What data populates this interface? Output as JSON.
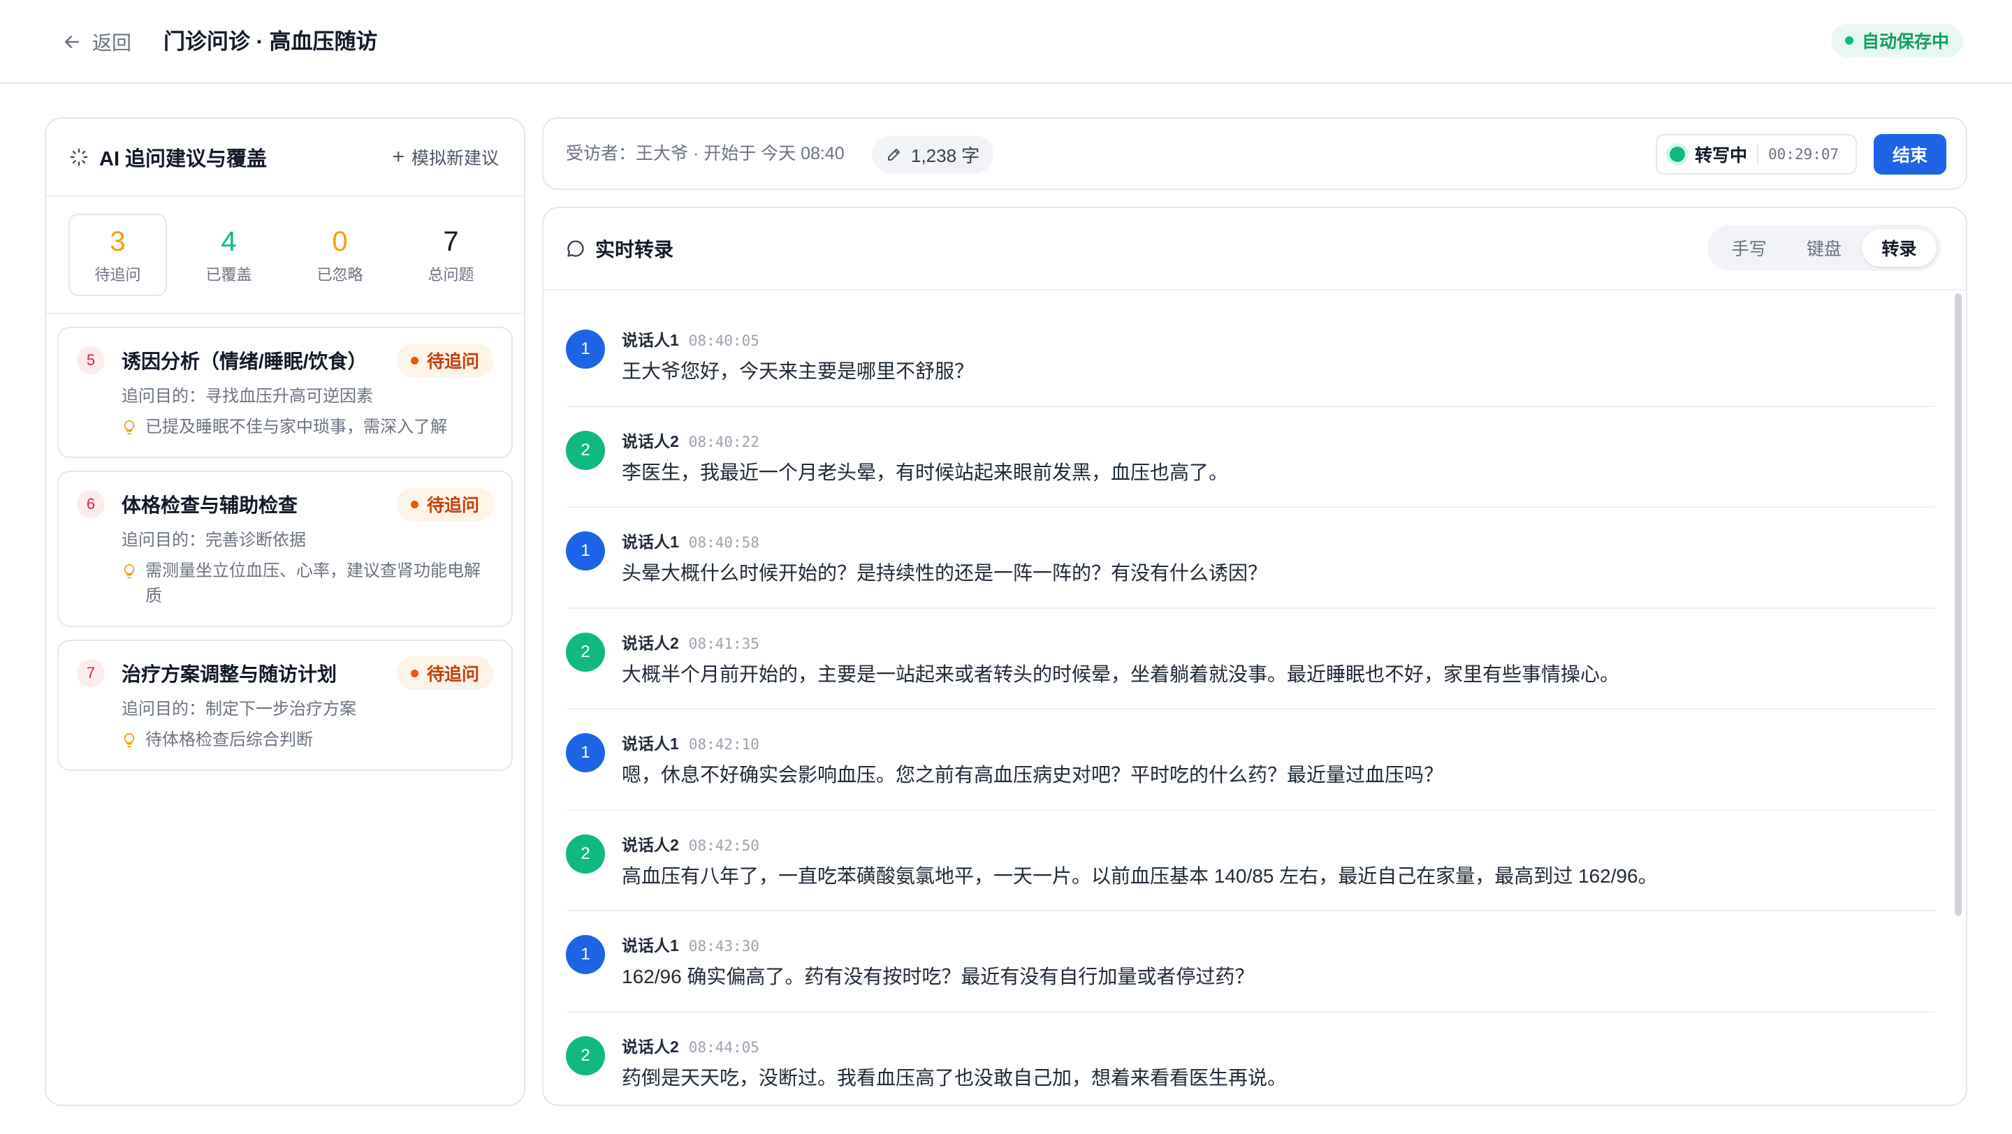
{
  "header": {
    "back_label": "返回",
    "title": "门诊问诊 · 高血压随访",
    "autosave_label": "自动保存中"
  },
  "sidebar": {
    "title": "AI 追问建议与覆盖",
    "simulate_label": "模拟新建议",
    "stats": [
      {
        "value": "3",
        "label": "待追问"
      },
      {
        "value": "4",
        "label": "已覆盖"
      },
      {
        "value": "0",
        "label": "已忽略"
      },
      {
        "value": "7",
        "label": "总问题"
      }
    ],
    "questions": [
      {
        "index": "5",
        "title": "诱因分析（情绪/睡眠/饮食）",
        "status": "待追问",
        "purpose": "追问目的：寻找血压升高可逆因素",
        "note": "已提及睡眠不佳与家中琐事，需深入了解"
      },
      {
        "index": "6",
        "title": "体格检查与辅助检查",
        "status": "待追问",
        "purpose": "追问目的：完善诊断依据",
        "note": "需测量坐立位血压、心率，建议查肾功能电解质"
      },
      {
        "index": "7",
        "title": "治疗方案调整与随访计划",
        "status": "待追问",
        "purpose": "追问目的：制定下一步治疗方案",
        "note": "待体格检查后综合判断"
      }
    ]
  },
  "session": {
    "interviewee": "受访者：王大爷 · 开始于 今天 08:40",
    "word_count": "1,238 字",
    "transcribing_label": "转写中",
    "timer": "00:29:07",
    "end_label": "结束"
  },
  "transcript": {
    "title": "实时转录",
    "tabs": [
      "手写",
      "键盘",
      "转录"
    ],
    "active_tab": "转录",
    "messages": [
      {
        "avatar": "1",
        "speaker": "说话人1",
        "time": "08:40:05",
        "text": "王大爷您好，今天来主要是哪里不舒服？"
      },
      {
        "avatar": "2",
        "speaker": "说话人2",
        "time": "08:40:22",
        "text": "李医生，我最近一个月老头晕，有时候站起来眼前发黑，血压也高了。"
      },
      {
        "avatar": "1",
        "speaker": "说话人1",
        "time": "08:40:58",
        "text": "头晕大概什么时候开始的？是持续性的还是一阵一阵的？有没有什么诱因？"
      },
      {
        "avatar": "2",
        "speaker": "说话人2",
        "time": "08:41:35",
        "text": "大概半个月前开始的，主要是一站起来或者转头的时候晕，坐着躺着就没事。最近睡眠也不好，家里有些事情操心。"
      },
      {
        "avatar": "1",
        "speaker": "说话人1",
        "time": "08:42:10",
        "text": "嗯，休息不好确实会影响血压。您之前有高血压病史对吧？平时吃的什么药？最近量过血压吗？"
      },
      {
        "avatar": "2",
        "speaker": "说话人2",
        "time": "08:42:50",
        "text": "高血压有八年了，一直吃苯磺酸氨氯地平，一天一片。以前血压基本 140/85 左右，最近自己在家量，最高到过 162/96。"
      },
      {
        "avatar": "1",
        "speaker": "说话人1",
        "time": "08:43:30",
        "text": "162/96 确实偏高了。药有没有按时吃？最近有没有自行加量或者停过药？"
      },
      {
        "avatar": "2",
        "speaker": "说话人2",
        "time": "08:44:05",
        "text": "药倒是天天吃，没断过。我看血压高了也没敢自己加，想着来看看医生再说。"
      }
    ]
  }
}
